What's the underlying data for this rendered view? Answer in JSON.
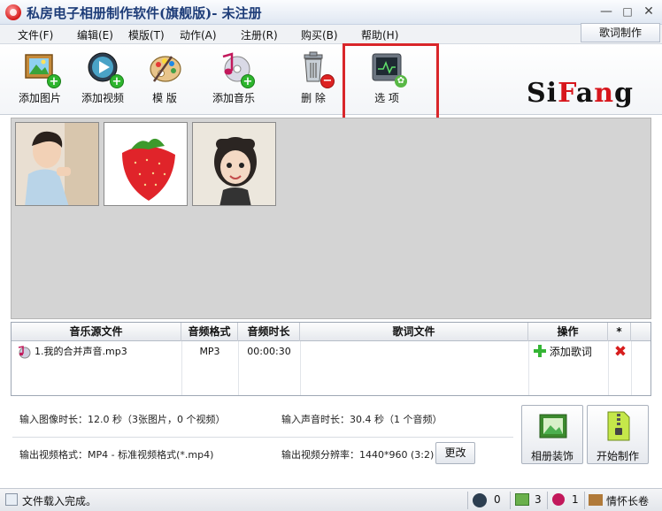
{
  "window": {
    "title": "私房电子相册制作软件(旗舰版)- 未注册",
    "min": "—",
    "max": "□",
    "close": "✕"
  },
  "menu": {
    "items": [
      "文件(F)",
      "编辑(E)",
      "模版(T)",
      "动作(A)",
      "注册(R)",
      "购买(B)",
      "帮助(H)"
    ],
    "lyrics_button": "歌词制作"
  },
  "toolbar": {
    "add_image": "添加图片",
    "add_video": "添加视频",
    "template": "模  版",
    "add_music": "添加音乐",
    "delete": "删  除",
    "options": "选  项"
  },
  "logo": {
    "part1": "Si",
    "part2": "F",
    "part3": "a",
    "part4": "n",
    "part5": "g"
  },
  "music_table": {
    "headers": [
      "音乐源文件",
      "音频格式",
      "音频时长",
      "歌词文件",
      "操作",
      "*"
    ],
    "rows": [
      {
        "file": "1.我的合并声音.mp3",
        "format": "MP3",
        "duration": "00:00:30",
        "lyrics": "",
        "action": "添加歌词"
      }
    ]
  },
  "info": {
    "image_duration": "输入图像时长：12.0 秒（3张图片，0 个视频）",
    "audio_duration": "输入声音时长：30.4 秒（1 个音频）",
    "video_format": "输出视频格式：MP4 - 标准视频格式(*.mp4)",
    "resolution": "输出视频分辨率：1440*960 (3:2)",
    "change_button": "更改",
    "decorate_button": "相册装饰",
    "start_button": "开始制作"
  },
  "status": {
    "message": "文件载入完成。",
    "video_count": "0",
    "image_count": "3",
    "audio_count": "1",
    "template_name": "情怀长卷"
  },
  "colors": {
    "highlight": "#d9262a",
    "logo_red": "#d7161c",
    "title_blue": "#1d3c78",
    "add_green": "#2db52d"
  }
}
